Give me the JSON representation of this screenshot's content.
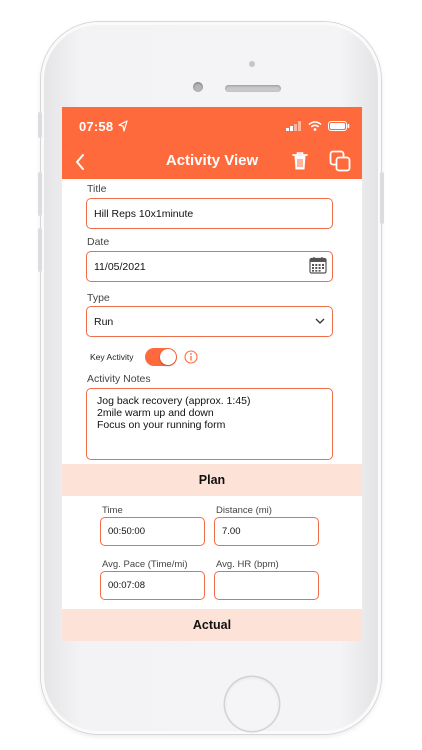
{
  "status_bar": {
    "time": "07:58"
  },
  "nav": {
    "title": "Activity View"
  },
  "form": {
    "title_label": "Title",
    "title_value": "Hill Reps 10x1minute",
    "date_label": "Date",
    "date_value": "11/05/2021",
    "type_label": "Type",
    "type_value": "Run",
    "key_activity_label": "Key Activity",
    "key_activity_on": true,
    "notes_label": "Activity Notes",
    "notes_lines": [
      "Jog back recovery (approx. 1:45)",
      "2mile warm up and down",
      "Focus on your running form"
    ]
  },
  "plan": {
    "header": "Plan",
    "time_label": "Time",
    "time_value": "00:50:00",
    "distance_label": "Distance (mi)",
    "distance_value": "7.00",
    "pace_label": "Avg. Pace (Time/mi)",
    "pace_value": "00:07:08",
    "hr_label": "Avg. HR (bpm)",
    "hr_value": ""
  },
  "actual": {
    "header": "Actual"
  },
  "colors": {
    "accent": "#ff6a3d",
    "section_bg": "#fde2d7",
    "field_border": "#ef6d49"
  }
}
